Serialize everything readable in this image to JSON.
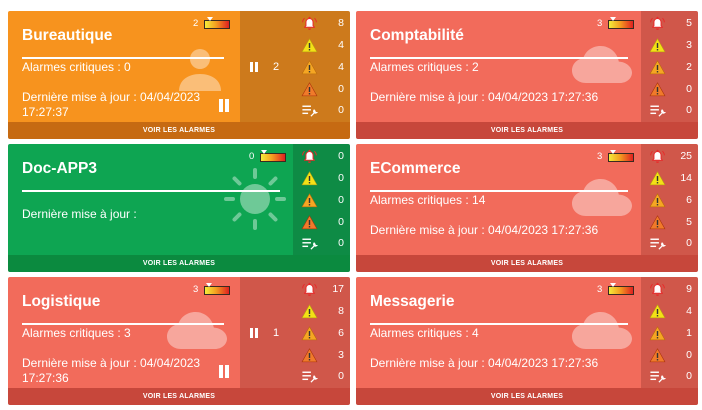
{
  "footer_label": "VOIR LES ALARMES",
  "colors": {
    "orange": "#f7931e",
    "green": "#0ea552",
    "red": "#f26b5b"
  },
  "tiles": [
    {
      "name": "Bureautique",
      "theme": "orange",
      "icon": "user-icon",
      "gauge_value": "2",
      "critical_label": "Alarmes critiques : 0",
      "update_label": "Dernière mise à jour : 04/04/2023 17:27:37",
      "paused_count": "2",
      "counts": {
        "bell": "8",
        "warning_yellow": "4",
        "warning_orange": "4",
        "warning_red": "0",
        "maintenance": "0"
      }
    },
    {
      "name": "Comptabilité",
      "theme": "red",
      "icon": "cloud-icon",
      "gauge_value": "3",
      "critical_label": "Alarmes critiques : 2",
      "update_label": "Dernière mise à jour : 04/04/2023 17:27:36",
      "counts": {
        "bell": "5",
        "warning_yellow": "3",
        "warning_orange": "2",
        "warning_red": "0",
        "maintenance": "0"
      }
    },
    {
      "name": "Doc-APP3",
      "theme": "green",
      "icon": "sun-icon",
      "gauge_value": "0",
      "update_label": "Dernière mise à jour :",
      "counts": {
        "bell": "0",
        "warning_yellow": "0",
        "warning_orange": "0",
        "warning_red": "0",
        "maintenance": "0"
      }
    },
    {
      "name": "ECommerce",
      "theme": "red",
      "icon": "cloud-icon",
      "gauge_value": "3",
      "critical_label": "Alarmes critiques : 14",
      "update_label": "Dernière mise à jour : 04/04/2023 17:27:36",
      "counts": {
        "bell": "25",
        "warning_yellow": "14",
        "warning_orange": "6",
        "warning_red": "5",
        "maintenance": "0"
      }
    },
    {
      "name": "Logistique",
      "theme": "red",
      "icon": "cloud-icon",
      "gauge_value": "3",
      "critical_label": "Alarmes critiques : 3",
      "update_label": "Dernière mise à jour : 04/04/2023 17:27:36",
      "paused_count": "1",
      "counts": {
        "bell": "17",
        "warning_yellow": "8",
        "warning_orange": "6",
        "warning_red": "3",
        "maintenance": "0"
      }
    },
    {
      "name": "Messagerie",
      "theme": "red",
      "icon": "cloud-icon",
      "gauge_value": "3",
      "critical_label": "Alarmes critiques : 4",
      "update_label": "Dernière mise à jour : 04/04/2023 17:27:36",
      "counts": {
        "bell": "9",
        "warning_yellow": "4",
        "warning_orange": "1",
        "warning_red": "0",
        "maintenance": "0"
      }
    }
  ]
}
